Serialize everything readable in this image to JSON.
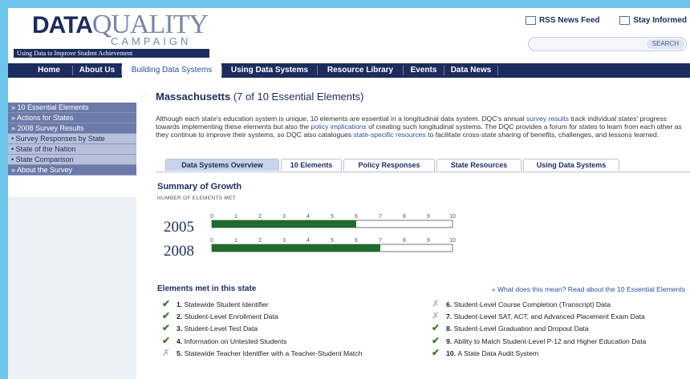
{
  "header": {
    "logo_bold": "DATA",
    "logo_rest": "QUALITY",
    "logo_sub": "CAMPAIGN",
    "tagline": "Using Data to Improve Student Achievement",
    "rss": "RSS News Feed",
    "stay_informed": "Stay Informed",
    "search_button": "SEARCH"
  },
  "nav": [
    "Home",
    "About Us",
    "Building Data Systems",
    "Using Data Systems",
    "Resource Library",
    "Events",
    "Data News"
  ],
  "sidebar": [
    {
      "label": "» 10 Essential Elements",
      "sub": false
    },
    {
      "label": "» Actions for States",
      "sub": false
    },
    {
      "label": "» 2008 Survey Results",
      "sub": false
    },
    {
      "label": "• Survey Responses by State",
      "sub": true
    },
    {
      "label": "• State of the Nation",
      "sub": true
    },
    {
      "label": "• State Comparison",
      "sub": true
    },
    {
      "label": "» About the Survey",
      "sub": false
    }
  ],
  "page": {
    "state": "Massachusetts",
    "count_text": "(7 of 10 Essential Elements)",
    "intro_1": "Although each state's education system is unique, 10 elements are essential in a longitudinal data system. DQC's annual ",
    "intro_link_1": "survey results",
    "intro_2": " track individual states' progress towards implementing these elements but also the ",
    "intro_link_2": "policy implications",
    "intro_3": " of creating such longitudinal systems. The DQC provides a forum for states to learn from each other as they continue to improve their systems, so DQC also catalogues ",
    "intro_link_3": "state-specific resources",
    "intro_4": " to facilitate cross-state sharing of benefits, challenges, and lessons learned."
  },
  "tabs": [
    "Data Systems Overview",
    "10 Elements",
    "Policy Responses",
    "State Resources",
    "Using Data Systems"
  ],
  "summary": {
    "title": "Summary of Growth",
    "subtitle": "NUMBER OF ELEMENTS MET"
  },
  "chart_data": {
    "type": "bar",
    "categories": [
      "2005",
      "2008"
    ],
    "values": [
      6,
      7
    ],
    "ticks": [
      "0",
      "1",
      "2",
      "3",
      "4",
      "5",
      "6",
      "7",
      "8",
      "9",
      "10"
    ],
    "xlim": [
      0,
      10
    ],
    "bar_color": "#1e6b2f"
  },
  "elements": {
    "title": "Elements met in this state",
    "link": "» What does this mean? Read about the 10 Essential Elements",
    "left": [
      {
        "num": "1.",
        "text": "Statewide Student Identifier",
        "met": true
      },
      {
        "num": "2.",
        "text": "Student-Level Enrollment Data",
        "met": true
      },
      {
        "num": "3.",
        "text": "Student-Level Test Data",
        "met": true
      },
      {
        "num": "4.",
        "text": "Information on Untested Students",
        "met": true
      },
      {
        "num": "5.",
        "text": "Statewide Teacher Identifier with a Teacher-Student Match",
        "met": false
      }
    ],
    "right": [
      {
        "num": "6.",
        "text": "Student-Level Course Completion (Transcript) Data",
        "met": false
      },
      {
        "num": "7.",
        "text": "Student-Level SAT, ACT, and Advanced Placement Exam Data",
        "met": false
      },
      {
        "num": "8.",
        "text": "Student-Level Graduation and Dropout Data",
        "met": true
      },
      {
        "num": "9.",
        "text": "Ability to Match Student-Level P-12 and Higher Education Data",
        "met": true
      },
      {
        "num": "10.",
        "text": "A State Data Audit System",
        "met": true
      }
    ]
  }
}
